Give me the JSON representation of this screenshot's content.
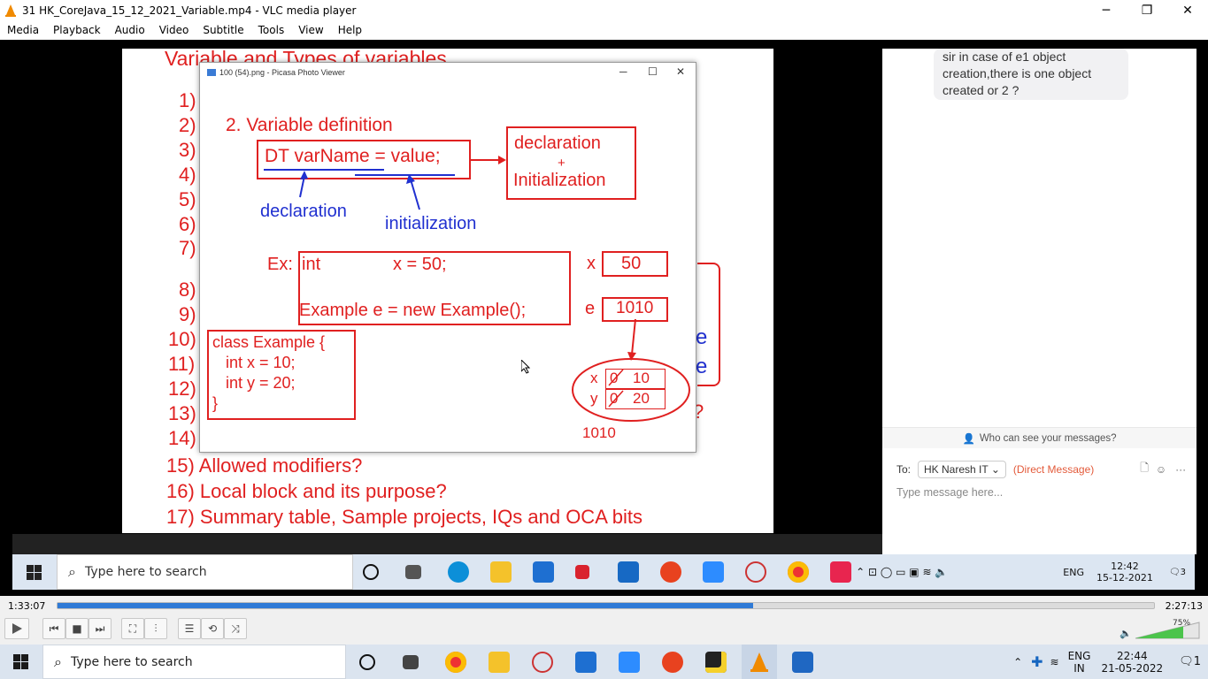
{
  "window": {
    "title": "31 HK_CoreJava_15_12_2021_Variable.mp4 - VLC media player",
    "controls": [
      "─",
      "❐",
      "✕"
    ]
  },
  "menu": [
    "Media",
    "Playback",
    "Audio",
    "Video",
    "Subtitle",
    "Tools",
    "View",
    "Help"
  ],
  "slide": {
    "title": "Variable and Types of variables",
    "numbers": [
      "1)",
      "2)",
      "3)",
      "4)",
      "5)",
      "6)",
      "7)",
      "8)",
      "9)",
      "10)",
      "11)",
      "12)",
      "13)",
      "14)"
    ],
    "item15": "15) Allowed modifiers?",
    "item16": "16) Local block and its purpose?",
    "item17": "17) Summary table, Sample projects, IQs and OCA bits",
    "right_e1": "e",
    "right_e2": "e",
    "right_q": "?"
  },
  "picasa": {
    "title": "100 (54).png - Picasa Photo Viewer",
    "heading": "2. Variable definition",
    "syntax": "DT  varName = value;",
    "decl_init_1": "declaration",
    "decl_init_plus": "+",
    "decl_init_2": "Initialization",
    "label_declaration": "declaration",
    "label_initialization": "initialization",
    "ex_label": "Ex:",
    "ex_line1_type": "int",
    "ex_line1_rest": "x = 50;",
    "ex_line2": "Example   e = new Example();",
    "var_x": "x",
    "val_x": "50",
    "var_e": "e",
    "val_e": "1010",
    "class_lines": [
      "class Example {",
      "   int x = 10;",
      "   int y = 20;",
      "}"
    ],
    "obj_x": "x",
    "obj_y": "y",
    "obj_x_old": "0",
    "obj_x_new": "10",
    "obj_y_old": "0",
    "obj_y_new": "20",
    "obj_addr": "1010"
  },
  "chat": {
    "message": "sir in case of e1 object creation,there is one object created or 2 ?",
    "who_can_see": "Who can see your messages?",
    "to_label": "To:",
    "recipient": "HK Naresh IT",
    "direct": "(Direct Message)",
    "placeholder": "Type message here..."
  },
  "inner_taskbar": {
    "search": "Type here to search",
    "lang": "ENG",
    "time": "12:42",
    "date": "15-12-2021",
    "notif": "3"
  },
  "player": {
    "elapsed": "1:33:07",
    "total": "2:27:13",
    "progress": 0.634,
    "volume": "75%"
  },
  "taskbar": {
    "search": "Type here to search",
    "lang1": "ENG",
    "lang2": "IN",
    "time": "22:44",
    "date": "21-05-2022",
    "notif": "1"
  },
  "colors": {
    "slide_red": "#e02020",
    "slide_blue": "#2030d0",
    "seek_blue": "#2f7ad6"
  }
}
